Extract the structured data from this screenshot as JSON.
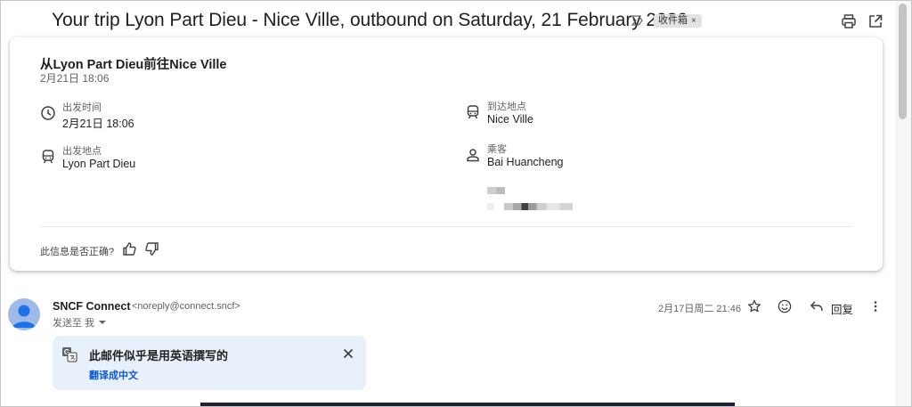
{
  "header": {
    "subject": "Your trip Lyon Part Dieu - Nice Ville, outbound on Saturday, 21 February 2026",
    "label_chip": "收件箱",
    "label_remove": "×",
    "icons": [
      "importance-marker-icon",
      "print-icon",
      "open-in-new-window-icon"
    ]
  },
  "summary_card": {
    "title": "从Lyon Part Dieu前往Nice Ville",
    "subtitle": "2月21日 18:06",
    "fields": {
      "departure_time": {
        "label": "出发时间",
        "value": "2月21日 18:06",
        "icon": "clock-icon"
      },
      "departure_place": {
        "label": "出发地点",
        "value": "Lyon Part Dieu",
        "icon": "train-icon"
      },
      "arrival_place": {
        "label": "到达地点",
        "value": "Nice Ville",
        "icon": "train-icon"
      },
      "passenger": {
        "label": "乘客",
        "value": "Bai Huancheng",
        "icon": "person-icon"
      }
    },
    "feedback_question": "此信息是否正确?",
    "feedback_icons": [
      "thumb-up-icon",
      "thumb-down-icon"
    ]
  },
  "message": {
    "sender_name": "SNCF Connect",
    "sender_email": "<noreply@connect.sncf>",
    "sent_to": "发送至 我",
    "date": "2月17日周二 21:46",
    "reply_label": "回复",
    "icons": [
      "star-icon",
      "emoji-reaction-icon",
      "reply-icon",
      "more-vert-icon"
    ]
  },
  "translate_banner": {
    "title": "此邮件似乎是用英语撰写的",
    "link": "翻译成中文",
    "icon": "translate-icon",
    "close_icon": "close-icon"
  },
  "colors": {
    "link_blue": "#0b57d0",
    "banner_bg": "#e8f0fb",
    "avatar_bg": "#9fb9e9",
    "avatar_fg": "#1a73e8",
    "chip_bg": "#e3e3e3"
  }
}
